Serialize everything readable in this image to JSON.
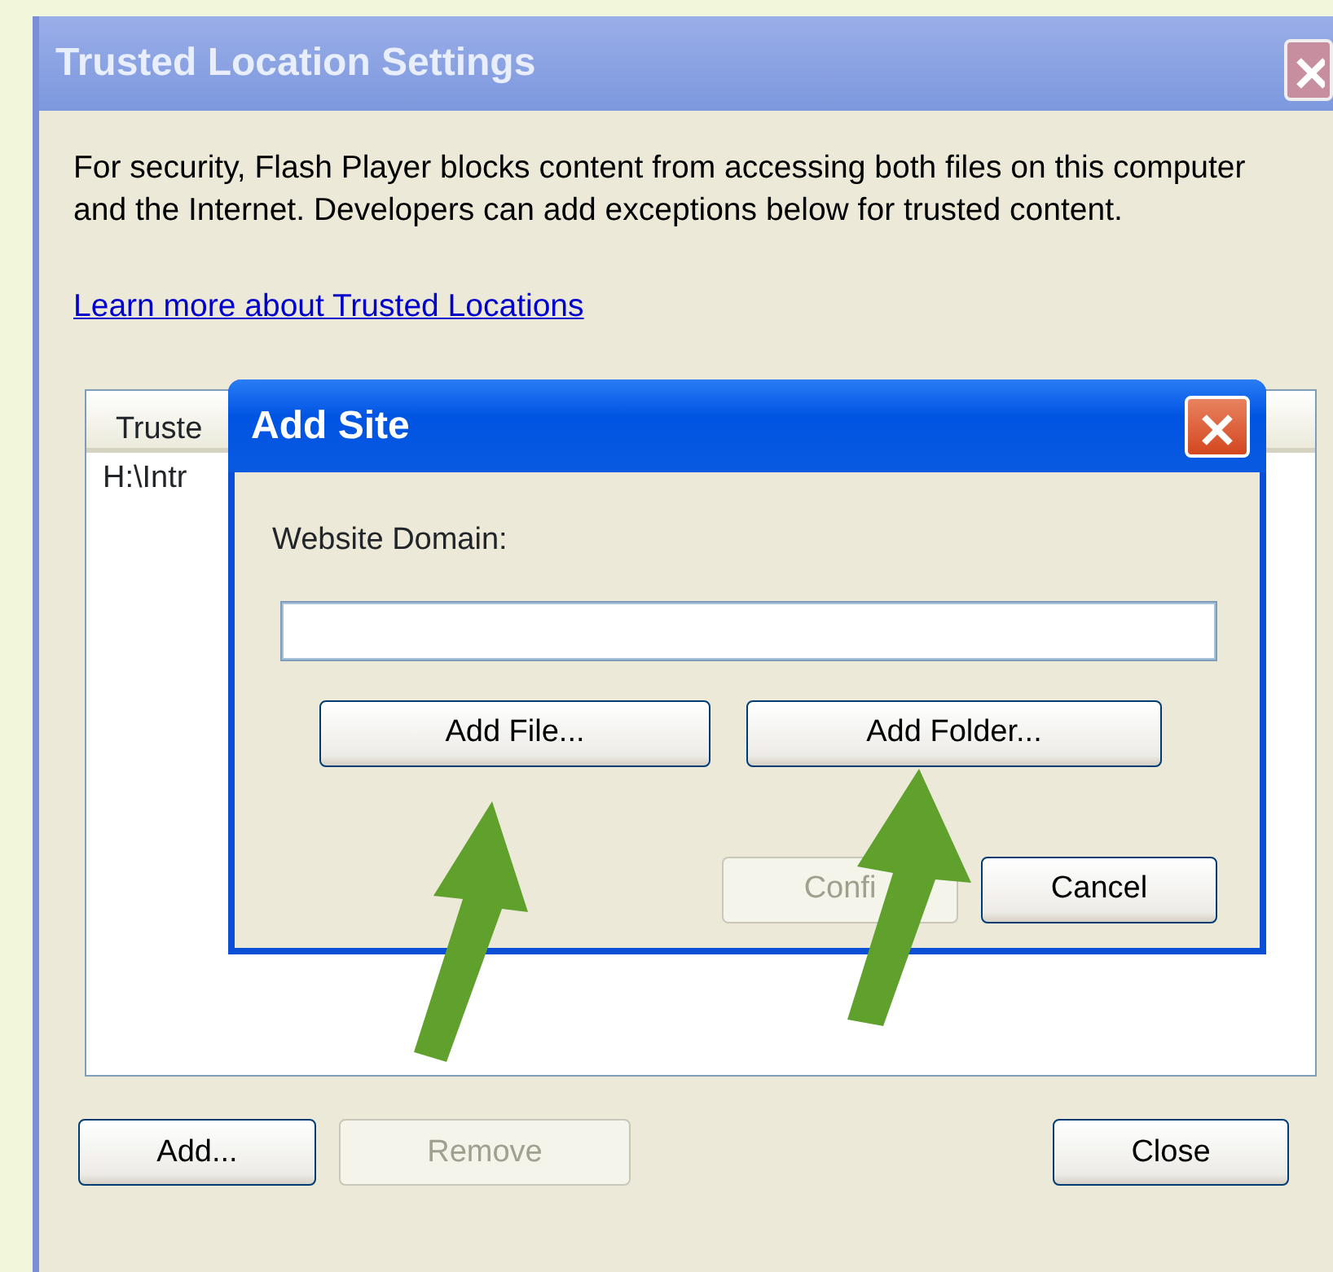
{
  "window": {
    "title": "Trusted Location Settings",
    "description": "For security, Flash Player blocks content from accessing both files on this computer and the Internet. Developers can add exceptions below for trusted content.",
    "link": "Learn more about Trusted Locations",
    "list": {
      "columns": [
        "Truste"
      ],
      "rows": [
        "H:\\Intr"
      ]
    },
    "buttons": [
      {
        "label": "Add...",
        "disabled": false,
        "kind": "left"
      },
      {
        "label": "Remove",
        "disabled": true,
        "kind": "left"
      },
      {
        "label": "Close",
        "disabled": false,
        "kind": "right"
      }
    ]
  },
  "dialog": {
    "title": "Add Site",
    "label": "Website Domain:",
    "field_focused": true,
    "browse_buttons": [
      {
        "label": "Add File...",
        "disabled": false
      },
      {
        "label": "Add Folder...",
        "disabled": false
      }
    ],
    "buttons": [
      {
        "label": "Confi",
        "disabled": true
      },
      {
        "label": "Cancel",
        "disabled": false
      }
    ]
  }
}
